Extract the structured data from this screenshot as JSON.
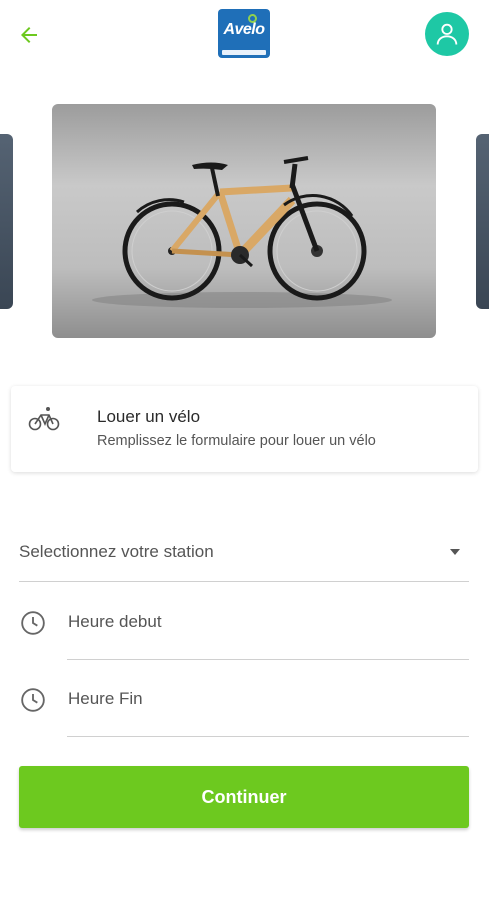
{
  "header": {
    "back_icon": "arrow-left-icon",
    "logo_text": "Avelo",
    "profile_icon": "user-icon"
  },
  "colors": {
    "accent_green": "#6dc91f",
    "avatar_teal": "#1ec8a5",
    "back_arrow": "#6dc91f"
  },
  "rent_card": {
    "icon": "bicycle-icon",
    "title": "Louer un vélo",
    "subtitle": "Remplissez le formulaire pour louer un vélo"
  },
  "form": {
    "station_placeholder": "Selectionnez votre station",
    "start_time_placeholder": "Heure debut",
    "end_time_placeholder": "Heure Fin",
    "clock_icon": "clock-icon"
  },
  "actions": {
    "continue_label": "Continuer"
  }
}
